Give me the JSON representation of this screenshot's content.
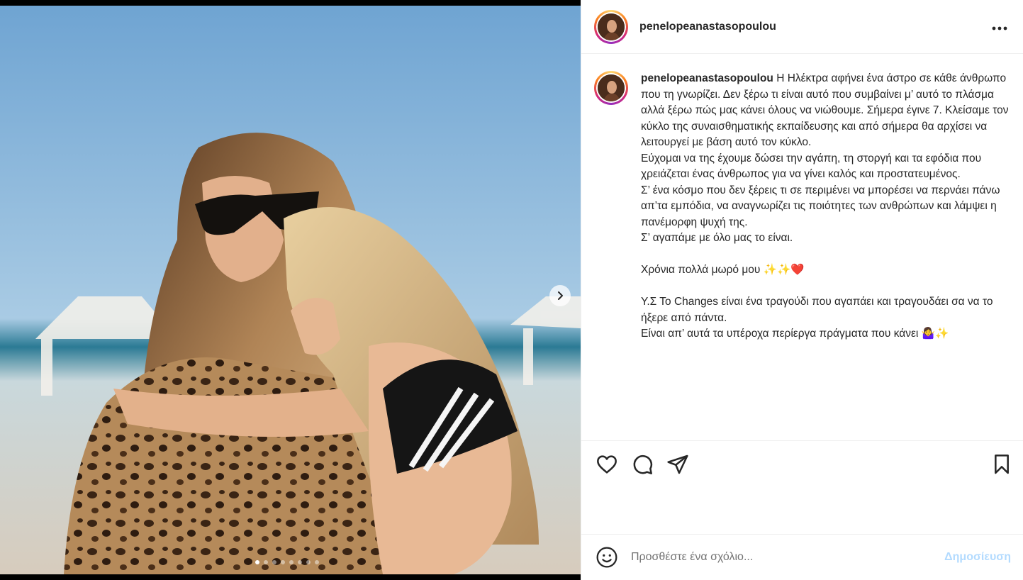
{
  "post": {
    "username": "penelopeanastasopoulou",
    "more_icon": "more-horizontal-icon",
    "caption": " Η Ηλέκτρα αφήνει ένα άστρο σε κάθε άνθρωπο που τη γνωρίζει. Δεν ξέρω τι είναι αυτό που συμβαίνει μ’ αυτό το πλάσμα αλλά ξέρω πώς μας κάνει όλους να νιώθουμε. Σήμερα έγινε 7. Κλείσαμε τον κύκλο της συναισθηματικής εκπαίδευσης και από σήμερα θα αρχίσει να λειτουργεί με βάση αυτό τον κύκλο.\nΕύχομαι να της έχουμε δώσει την αγάπη, τη στοργή και τα εφόδια που χρειάζεται ένας άνθρωπος για να γίνει καλός και προστατευμένος.\nΣ’ ένα κόσμο που δεν ξέρεις τι σε περιμένει να μπορέσει να περνάει πάνω απ’τα εμπόδια, να αναγνωρίζει τις ποιότητες των ανθρώπων και λάμψει η πανέμορφη ψυχή της.\nΣ’ αγαπάμε με όλο μας το είναι.\n\nΧρόνια πολλά μωρό μου ✨✨❤️\n\nΥ.Σ Το Changes είναι ένα τραγούδι που αγαπάει και τραγουδάει σα να το ήξερε από πάντα.\nΕίναι απ’ αυτά τα υπέροχα περίεργα πράγματα που κάνει 🤷‍♀️✨"
  },
  "carousel": {
    "slide_count": 8,
    "active_index": 0,
    "next_icon": "chevron-right-icon"
  },
  "actions": {
    "like_icon": "heart-icon",
    "comment_icon": "comment-icon",
    "share_icon": "send-icon",
    "save_icon": "bookmark-icon"
  },
  "comment_bar": {
    "emoji_icon": "emoji-icon",
    "placeholder": "Προσθέστε ένα σχόλιο...",
    "post_label": "Δημοσίευση"
  },
  "colors": {
    "post_button": "#b3dbff",
    "divider": "#efefef",
    "text": "#262626"
  }
}
